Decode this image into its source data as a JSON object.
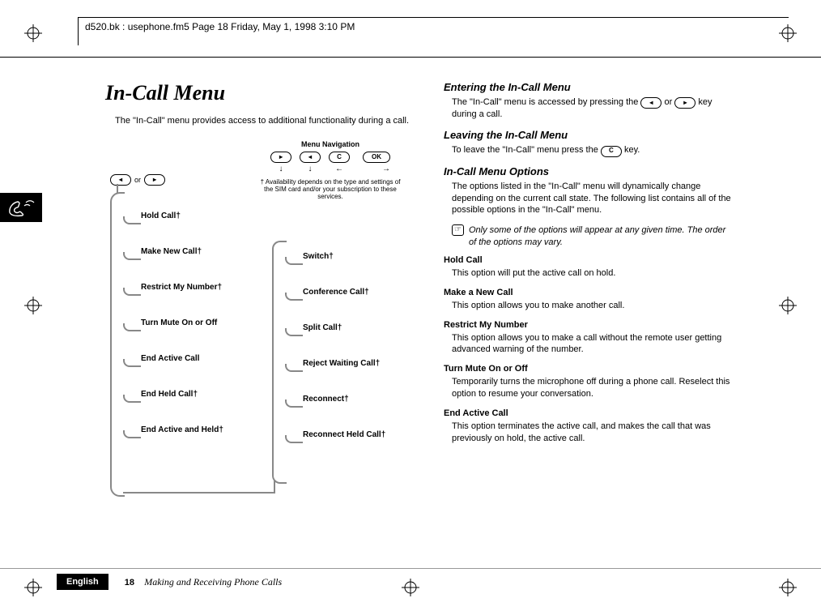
{
  "header": "d520.bk : usephone.fm5  Page 18  Friday, May 1, 1998  3:10 PM",
  "title": "In-Call Menu",
  "intro": "The \"In-Call\" menu provides access to additional functionality during a call.",
  "key_left_glyph": "◂",
  "key_right_glyph": "▸",
  "key_or": "or",
  "nav": {
    "label": "Menu Navigation",
    "ok": "OK",
    "c": "C",
    "footnote": "†  Availability depends on the type and settings of the SIM card and/or your subscription to these services."
  },
  "menu_left": [
    "Hold Call†",
    "Make New Call†",
    "Restrict My Number†",
    "Turn Mute On or Off",
    "End Active Call",
    "End Held Call†",
    "End Active and Held†"
  ],
  "menu_right": [
    "Switch†",
    "Conference Call†",
    "Split Call†",
    "Reject Waiting Call†",
    "Reconnect†",
    "Reconnect Held Call†"
  ],
  "right": {
    "s1_h": "Entering the In-Call Menu",
    "s1_p_a": "The \"In-Call\" menu is accessed by pressing the ",
    "s1_p_b": " or ",
    "s1_p_c": " key during a call.",
    "s2_h": "Leaving the In-Call Menu",
    "s2_p_a": "To leave the \"In-Call\" menu press the ",
    "s2_p_b": " key.",
    "s3_h": "In-Call Menu Options",
    "s3_p": "The options listed in the \"In-Call\" menu will dynamically change depending on the current call state. The following list contains all of the possible options in the \"In-Call\" menu.",
    "note": "Only some of the options will appear at any given time. The order of the options may vary.",
    "opts": [
      {
        "h": "Hold Call",
        "p": "This option will put the active call on hold."
      },
      {
        "h": "Make a New Call",
        "p": "This option allows you to make another call."
      },
      {
        "h": "Restrict My Number",
        "p": "This option allows you to make a call without the remote user getting advanced warning of the number."
      },
      {
        "h": "Turn Mute On or Off",
        "p": "Temporarily turns the microphone off during a phone call. Reselect this option to resume your conversation."
      },
      {
        "h": "End Active Call",
        "p": "This option terminates the active call, and makes the call that was previously on hold, the active call."
      }
    ]
  },
  "footer": {
    "lang": "English",
    "page": "18",
    "chapter": "Making and Receiving Phone Calls"
  }
}
